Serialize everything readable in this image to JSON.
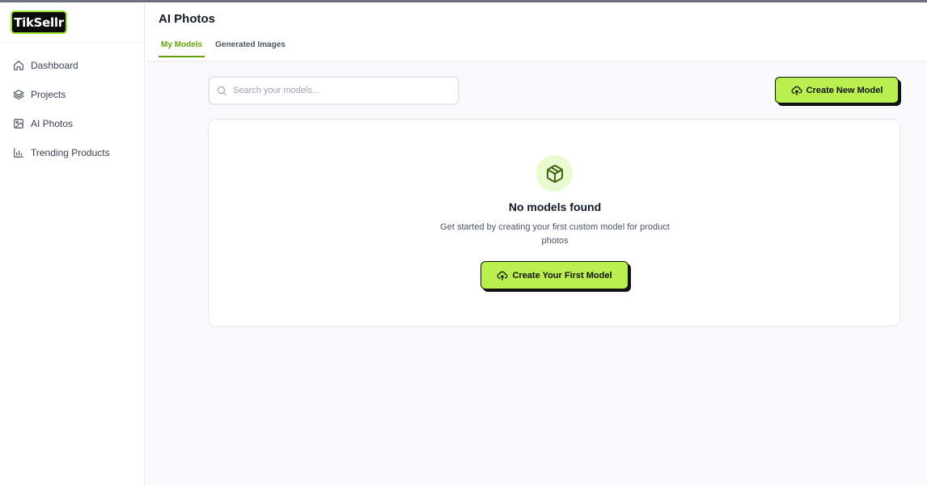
{
  "app": {
    "logo_text": "TikSellr"
  },
  "sidebar": {
    "items": [
      {
        "label": "Dashboard",
        "icon": "home-icon"
      },
      {
        "label": "Projects",
        "icon": "layers-icon"
      },
      {
        "label": "AI Photos",
        "icon": "image-icon"
      },
      {
        "label": "Trending Products",
        "icon": "bar-chart-icon"
      }
    ]
  },
  "header": {
    "title": "AI Photos",
    "tabs": [
      {
        "label": "My Models",
        "active": true
      },
      {
        "label": "Generated Images",
        "active": false
      }
    ]
  },
  "toolbar": {
    "search_placeholder": "Search your models...",
    "create_new_label": "Create New Model"
  },
  "empty_state": {
    "icon": "package-icon",
    "title": "No models found",
    "description": "Get started by creating your first custom model for product photos",
    "button_label": "Create Your First Model"
  },
  "colors": {
    "accent": "#b9ef4f",
    "accent_dark": "#65a30d",
    "icon_bg": "#e9fad0"
  }
}
